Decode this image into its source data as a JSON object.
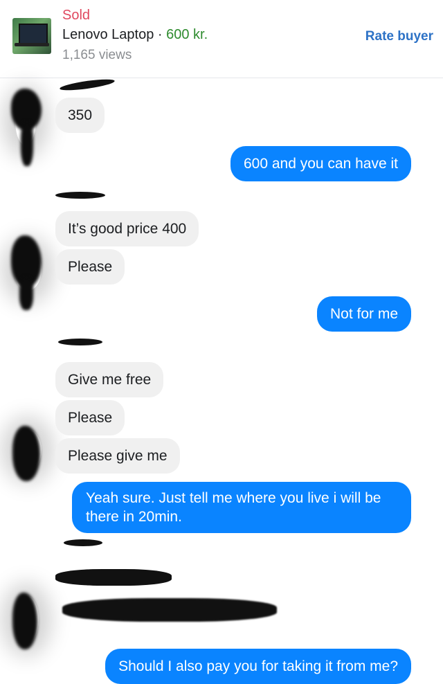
{
  "listing": {
    "status": "Sold",
    "title": "Lenovo Laptop",
    "separator": " · ",
    "price": "600 kr.",
    "views": "1,165 views",
    "rate_button": "Rate buyer"
  },
  "messages": [
    {
      "from": "buyer",
      "text": "350"
    },
    {
      "from": "seller",
      "text": "600 and you can have it"
    },
    {
      "from": "buyer",
      "text": "It’s good price 400"
    },
    {
      "from": "buyer",
      "text": "Please"
    },
    {
      "from": "seller",
      "text": "Not for me"
    },
    {
      "from": "buyer",
      "text": "Give me free"
    },
    {
      "from": "buyer",
      "text": "Please"
    },
    {
      "from": "buyer",
      "text": "Please give me"
    },
    {
      "from": "seller",
      "text": "Yeah sure. Just tell me where you live i will be there in 20min."
    },
    {
      "from": "seller",
      "text": "Should I also pay you for taking it from me?"
    }
  ],
  "colors": {
    "outgoing_bubble": "#0a84ff",
    "incoming_bubble": "#f0f0f0",
    "sold": "#e0485f",
    "price": "#2e8b2e",
    "rate_button": "#2d72c6"
  }
}
